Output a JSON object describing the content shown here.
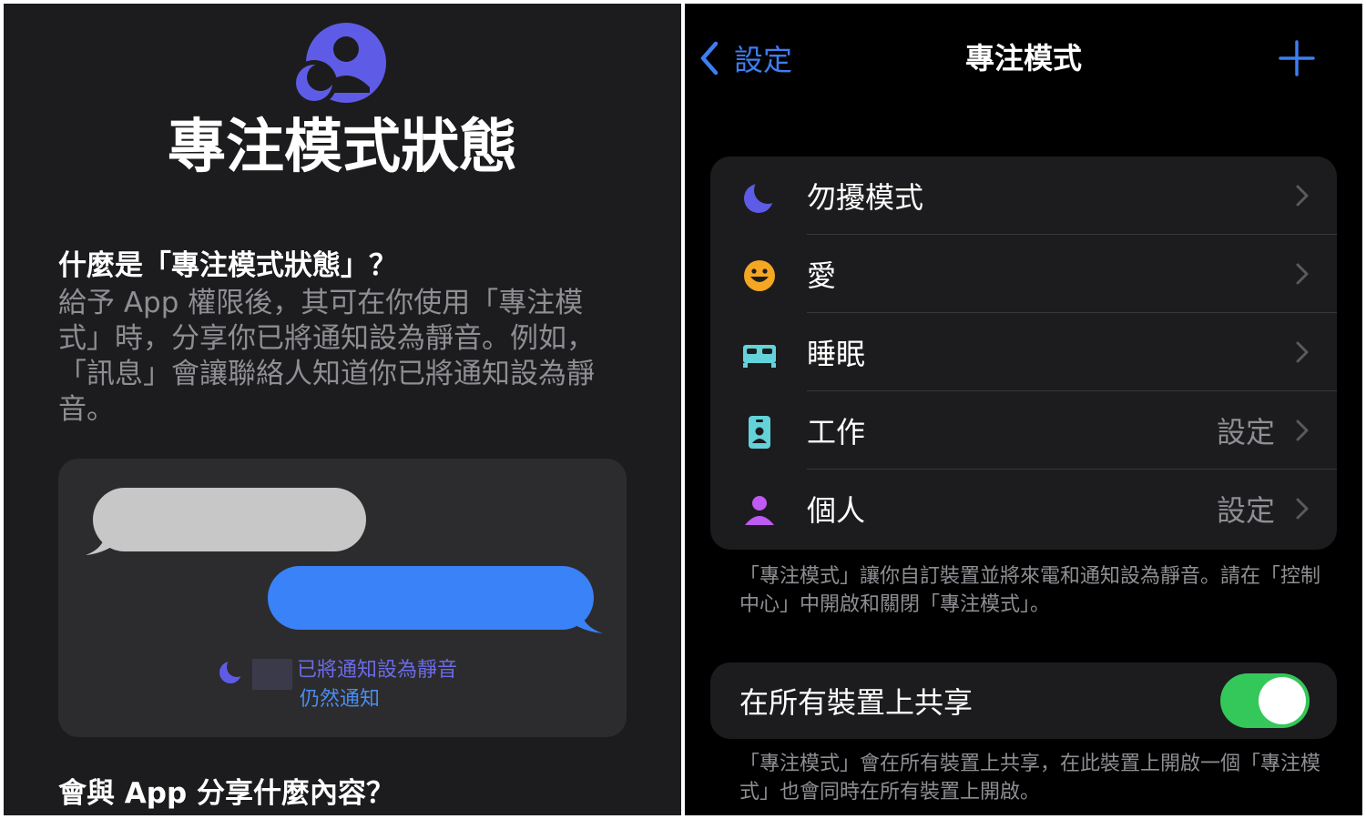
{
  "left": {
    "title": "專注模式狀態",
    "question1": "什麼是「專注模式狀態」？",
    "description": "給予 App 權限後，其可在你使用「專注模式」時，分享你已將通知設為靜音。例如，「訊息」會讓聯絡人知道你已將通知設為靜音。",
    "preview": {
      "silenced_text": "已將通知設為靜音",
      "notify_anyway": "仍然通知"
    },
    "question2": "會與 App 分享什麼內容？",
    "colors": {
      "logo": "#5e5ce6",
      "blue_bubble": "#3a82f7",
      "gray_bubble": "#c7c7c7"
    }
  },
  "right": {
    "nav": {
      "back_label": "設定",
      "title": "專注模式",
      "add_icon": "plus-icon"
    },
    "focus_modes": [
      {
        "label": "勿擾模式",
        "value": "",
        "icon": "moon-icon",
        "color": "#5e5ce6"
      },
      {
        "label": "愛",
        "value": "",
        "icon": "smiley-icon",
        "color": "#f5a623"
      },
      {
        "label": "睡眠",
        "value": "",
        "icon": "bed-icon",
        "color": "#64d2d9"
      },
      {
        "label": "工作",
        "value": "設定",
        "icon": "id-badge-icon",
        "color": "#64d2d9"
      },
      {
        "label": "個人",
        "value": "設定",
        "icon": "person-icon",
        "color": "#bf5af2"
      }
    ],
    "footnote1": "「專注模式」讓你自訂裝置並將來電和通知設為靜音。請在「控制中心」中開啟和關閉「專注模式」。",
    "share": {
      "label": "在所有裝置上共享",
      "enabled": true,
      "color": "#34c759"
    },
    "footnote2": "「專注模式」會在所有裝置上共享，在此裝置上開啟一個「專注模式」也會同時在所有裝置上開啟。"
  }
}
